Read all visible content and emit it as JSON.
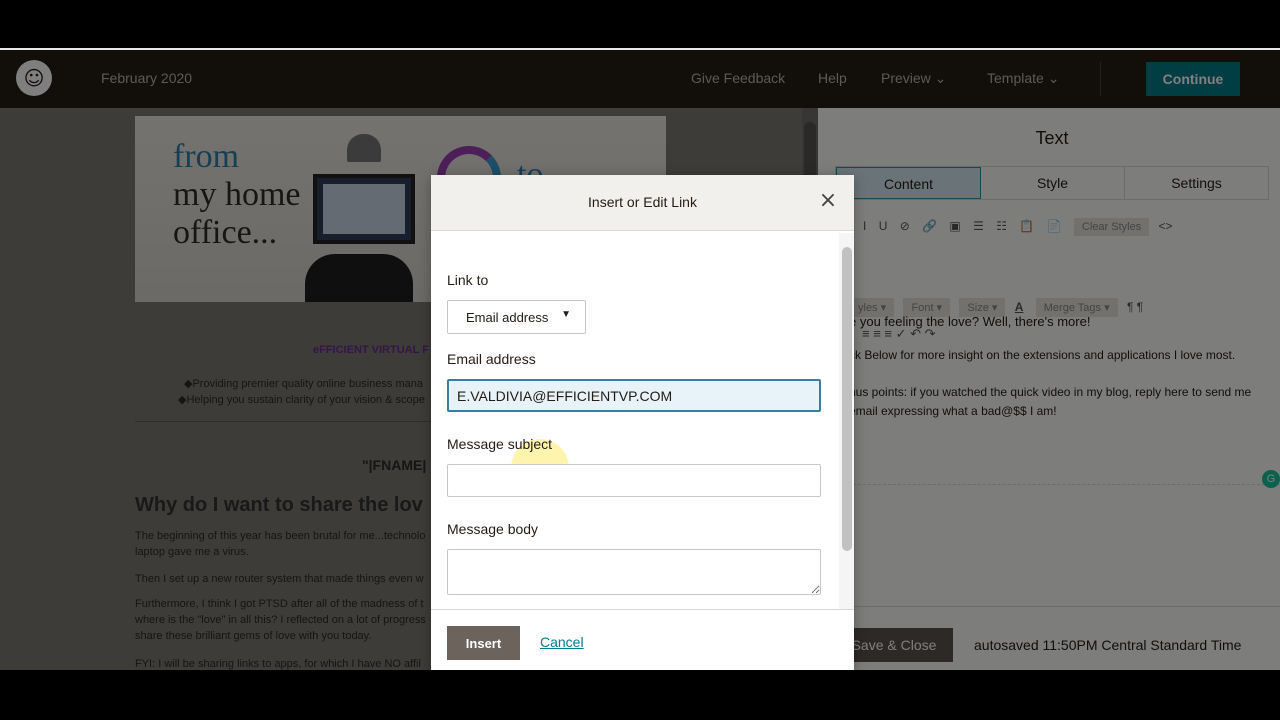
{
  "topbar": {
    "title": "February 2020",
    "links": [
      "Give Feedback",
      "Help",
      "Preview ⌄",
      "Template ⌄"
    ],
    "continue_label": "Continue"
  },
  "email": {
    "hero_from": "from",
    "hero_line2": "my home",
    "hero_line3": "office...",
    "hero_to": "to",
    "org_name": "eFFICIENT VIRTUAL F",
    "bullet1": "◆Providing premier quality online business mana",
    "bullet2": "◆Helping you sustain clarity of your vision & scope",
    "fname": "\"|FNAME|",
    "heading": "Why do I want to share the lov",
    "para1a": "The beginning of this year has been brutal for me...technolo",
    "para1b": "laptop gave me a virus.",
    "para2": "Then I set up a new router system that made things even w",
    "para3a": "Furthermore, I think I got PTSD after all of the madness of t",
    "para3b": "where is the \"love\" in all this? I reflected on a lot of progress",
    "para3c": "share these brilliant gems of love with you today.",
    "para4": "FYI: I will be sharing links to apps, for which I have NO affil"
  },
  "panel": {
    "title": "Text",
    "tabs": [
      "Content",
      "Style",
      "Settings"
    ],
    "toolbar_row1": [
      "I",
      "U",
      "⊘",
      "🔗",
      "▣",
      "☰",
      "☷",
      "📋",
      "📄"
    ],
    "clear_styles": "Clear Styles",
    "code": "<>",
    "toolbar_row2": [
      "yles ▾",
      "Font ▾",
      "Size ▾"
    ],
    "font_color": "A",
    "merge_tags": "Merge Tags ▾",
    "para_marks": "¶  ¶",
    "toolbar_row3": "≡  ≡  ≡  ✓  ↶  ↷",
    "editor": {
      "line1": "e you feeling the love? Well, there's more!",
      "line2": "ck Below for more insight on the extensions and applications I love most.",
      "line3": "nus points: if you watched the quick video in my blog, reply here to send me",
      "line4": "email expressing what a bad@$$ I am!"
    },
    "save_close": "Save & Close",
    "autosaved": "autosaved 11:50PM Central Standard Time"
  },
  "modal": {
    "title": "Insert or Edit Link",
    "link_to_label": "Link to",
    "link_to_value": "Email address",
    "email_label": "Email address",
    "email_value": "E.VALDIVIA@EFFICIENTVP.COM",
    "subject_label": "Message subject",
    "subject_value": "",
    "body_label": "Message body",
    "body_value": "",
    "insert_label": "Insert",
    "cancel_label": "Cancel"
  }
}
